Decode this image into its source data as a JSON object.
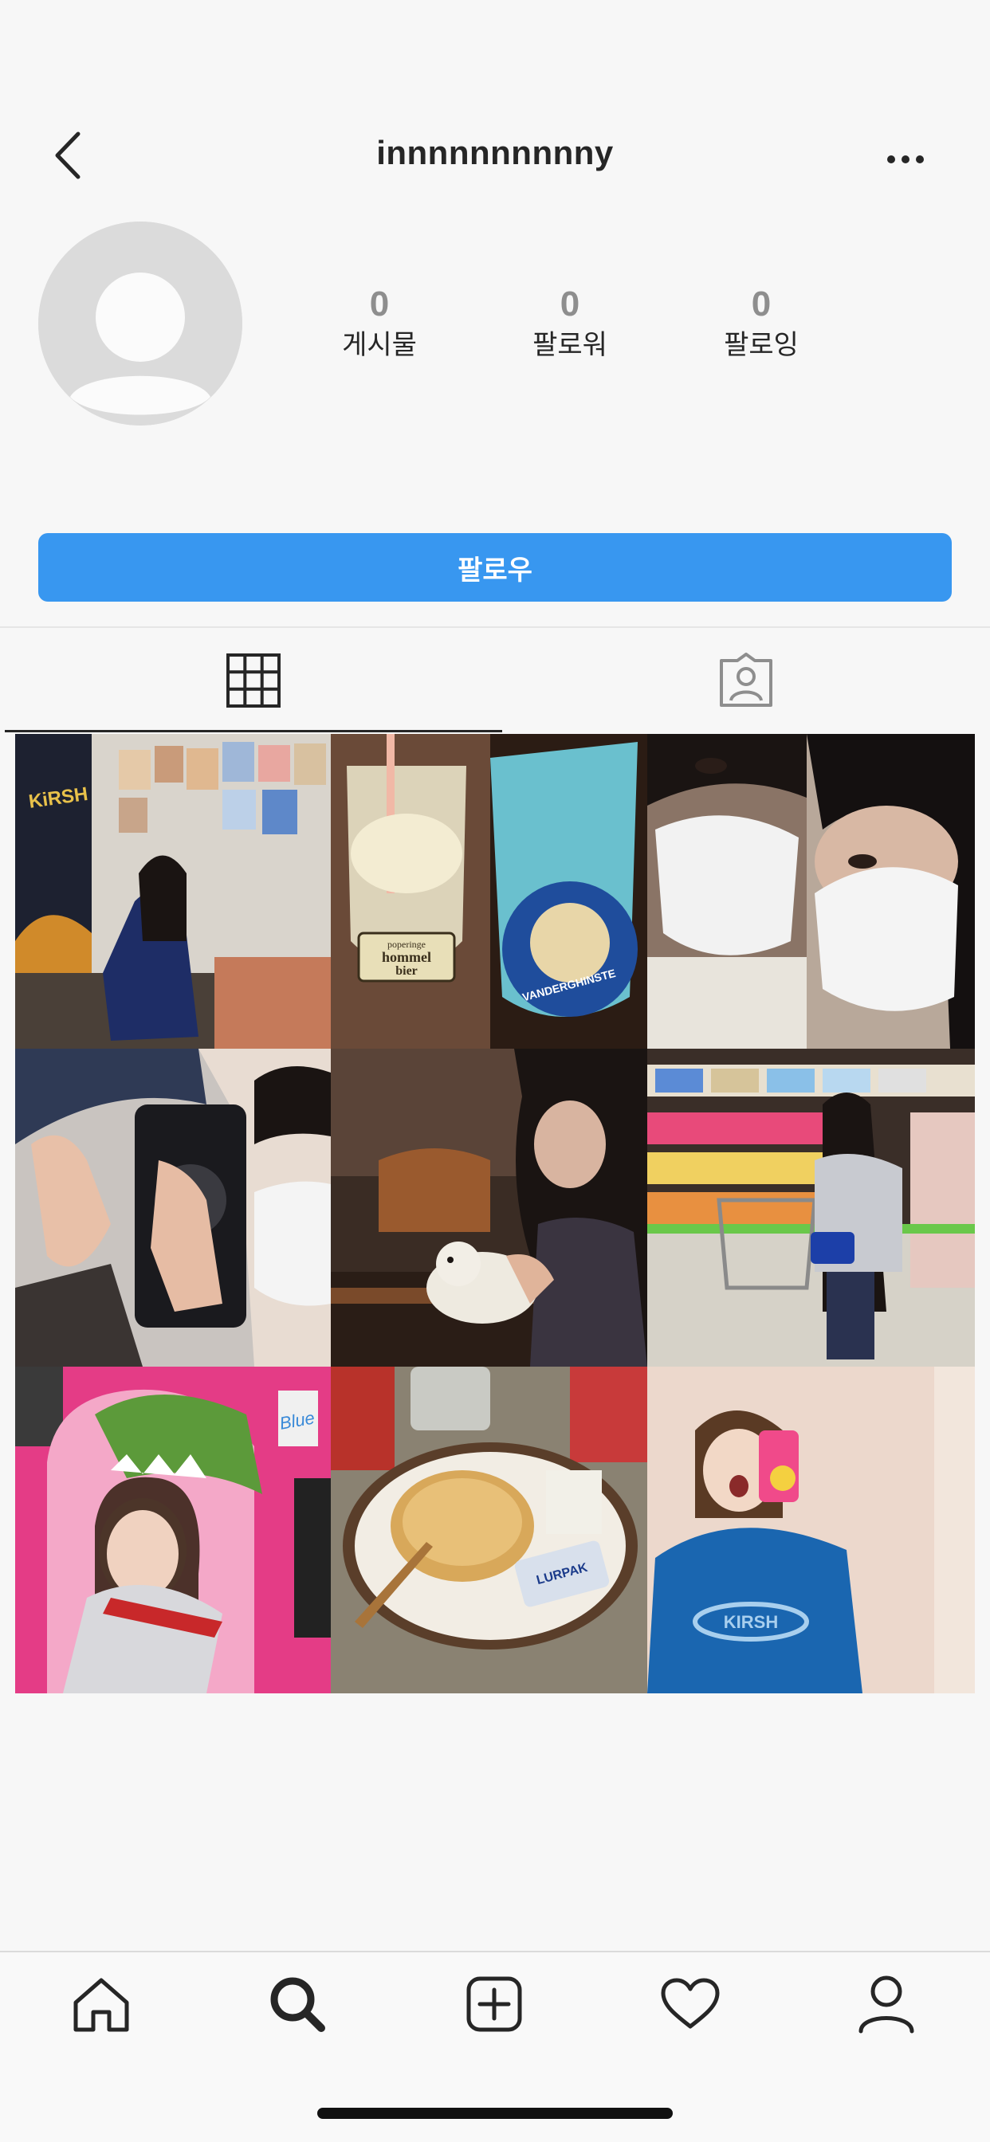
{
  "header": {
    "username": "innnnnnnnnny",
    "back_icon": "chevron-left-icon",
    "more_icon": "more-horizontal-icon"
  },
  "profile": {
    "avatar_icon": "default-avatar-icon",
    "stats": [
      {
        "value": "0",
        "label": "게시물"
      },
      {
        "value": "0",
        "label": "팔로워"
      },
      {
        "value": "0",
        "label": "팔로잉"
      }
    ],
    "follow_label": "팔로우"
  },
  "tabs": [
    {
      "icon": "grid-icon",
      "active": true
    },
    {
      "icon": "tagged-user-icon",
      "active": false
    }
  ],
  "grid": {
    "photos": [
      {
        "subject": "girl in blue hoodie in cafe with portraits on wall"
      },
      {
        "subject": "two drinks: hommel bier glass and blue soda"
      },
      {
        "subject": "two masked selfie"
      },
      {
        "subject": "mirror selfie with cap and phone"
      },
      {
        "subject": "girl with stuffed animal at table"
      },
      {
        "subject": "girl with shopping cart in store aisle"
      },
      {
        "subject": "girl with dinosaur hat pink wall"
      },
      {
        "subject": "plate of food with butter packet"
      },
      {
        "subject": "mirror selfie blue hoodie surprised"
      }
    ],
    "text_in_photos": {
      "photo1_wall": "KiRSH",
      "photo2_glass": "hommel bier",
      "photo2_label": "poperinge",
      "photo2_blue": "VANDERGHINSTE",
      "photo7_sign": "Blue",
      "photo8_packet": "LURPAK",
      "photo9_hoodie": "KIRSH"
    }
  },
  "bottom_nav": [
    {
      "icon": "home-icon"
    },
    {
      "icon": "search-icon",
      "active": true
    },
    {
      "icon": "add-post-icon"
    },
    {
      "icon": "heart-icon"
    },
    {
      "icon": "profile-icon"
    }
  ],
  "colors": {
    "accent": "#3897f0",
    "background": "#f7f7f7",
    "text": "#262626",
    "muted": "#8e8e8e"
  }
}
